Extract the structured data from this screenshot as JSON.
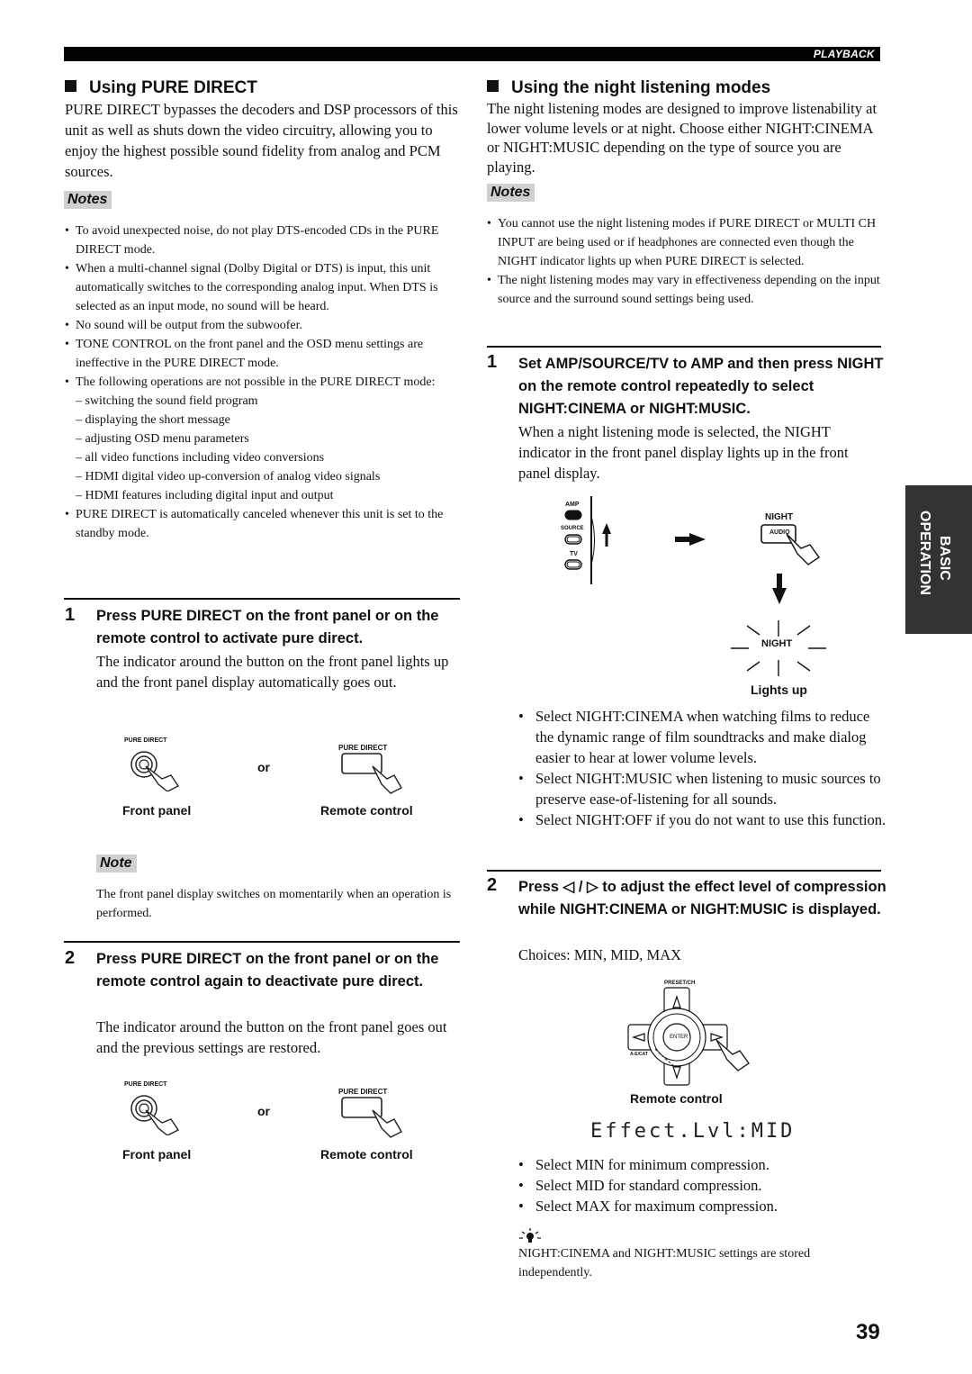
{
  "header": {
    "section": "PLAYBACK"
  },
  "side_tab": {
    "line1": "BASIC",
    "line2": "OPERATION"
  },
  "left": {
    "title": "Using PURE DIRECT",
    "intro": "PURE DIRECT bypasses the decoders and DSP processors of this unit as well as shuts down the video circuitry, allowing you to enjoy the highest possible sound fidelity from analog and PCM sources.",
    "notes_label": "Notes",
    "notes": [
      "To avoid unexpected noise, do not play DTS-encoded CDs in the PURE DIRECT mode.",
      "When a multi-channel signal (Dolby Digital or DTS) is input, this unit automatically switches to the corresponding analog input. When DTS is selected as an input mode, no sound will be heard.",
      "No sound will be output from the subwoofer.",
      "TONE CONTROL on the front panel and the OSD menu settings are ineffective in the PURE DIRECT mode.",
      "The following operations are not possible in the PURE DIRECT mode:"
    ],
    "sub_notes": [
      "– switching the sound field program",
      "– displaying the short message",
      "– adjusting OSD menu parameters",
      "– all video functions including video conversions",
      "– HDMI digital video up-conversion of analog video signals",
      "– HDMI features including digital input and output"
    ],
    "last_note": "PURE DIRECT is automatically canceled whenever this unit is set to the standby mode.",
    "step1": {
      "num": "1",
      "title": "Press PURE DIRECT on the front panel or on the remote control to activate pure direct.",
      "body": "The indicator around the button on the front panel lights up and the front panel display automatically goes out."
    },
    "figure": {
      "front_label_small": "PURE DIRECT",
      "remote_label_small": "PURE DIRECT",
      "or": "or",
      "front_caption": "Front panel",
      "remote_caption": "Remote control"
    },
    "note_label": "Note",
    "note_text": "The front panel display switches on momentarily when an operation is performed.",
    "step2": {
      "num": "2",
      "title": "Press PURE DIRECT on the front panel or on the remote control again to deactivate pure direct.",
      "body": "The indicator around the button on the front panel goes out and the previous settings are restored."
    }
  },
  "right": {
    "title": "Using the night listening modes",
    "intro": "The night listening modes are designed to improve listenability at lower volume levels or at night. Choose either NIGHT:CINEMA or NIGHT:MUSIC depending on the type of source you are playing.",
    "notes_label": "Notes",
    "notes": [
      "You cannot use the night listening modes if PURE DIRECT or MULTI CH INPUT are being used or if headphones are connected even though the NIGHT indicator lights up when PURE DIRECT is selected.",
      "The night listening modes may vary in effectiveness depending on the input source and the surround sound settings being used."
    ],
    "step1": {
      "num": "1",
      "title": "Set AMP/SOURCE/TV to AMP and then press NIGHT on the remote control repeatedly to select NIGHT:CINEMA or NIGHT:MUSIC.",
      "body": "When a night listening mode is selected, the NIGHT indicator in the front panel display lights up in the front panel display."
    },
    "figure1": {
      "amp": "AMP",
      "source": "SOURCE",
      "tv": "TV",
      "night_button_label": "NIGHT",
      "audio": "AUDIO",
      "indicator": "NIGHT",
      "caption": "Lights up"
    },
    "bullets1": [
      "Select NIGHT:CINEMA when watching films to reduce the dynamic range of film soundtracks and make dialog easier to hear at lower volume levels.",
      "Select NIGHT:MUSIC when listening to music sources to preserve ease-of-listening for all sounds.",
      "Select NIGHT:OFF if you do not want to use this function."
    ],
    "step2": {
      "num": "2",
      "title": "Press ◁ / ▷ to adjust the effect level of compression while NIGHT:CINEMA or NIGHT:MUSIC is displayed.",
      "body": "Choices: MIN, MID, MAX"
    },
    "figure2": {
      "preset": "PRESET/CH",
      "enter": "ENTER",
      "aecat": "A-E/CAT",
      "caption": "Remote control"
    },
    "display": "Effect.Lvl:MID",
    "bullets2": [
      "Select MIN for minimum compression.",
      "Select MID for standard compression.",
      "Select MAX for maximum compression."
    ],
    "tip_icon": "lightbulb-tip-icon",
    "tip": "NIGHT:CINEMA and NIGHT:MUSIC settings are stored independently."
  },
  "page_number": "39"
}
